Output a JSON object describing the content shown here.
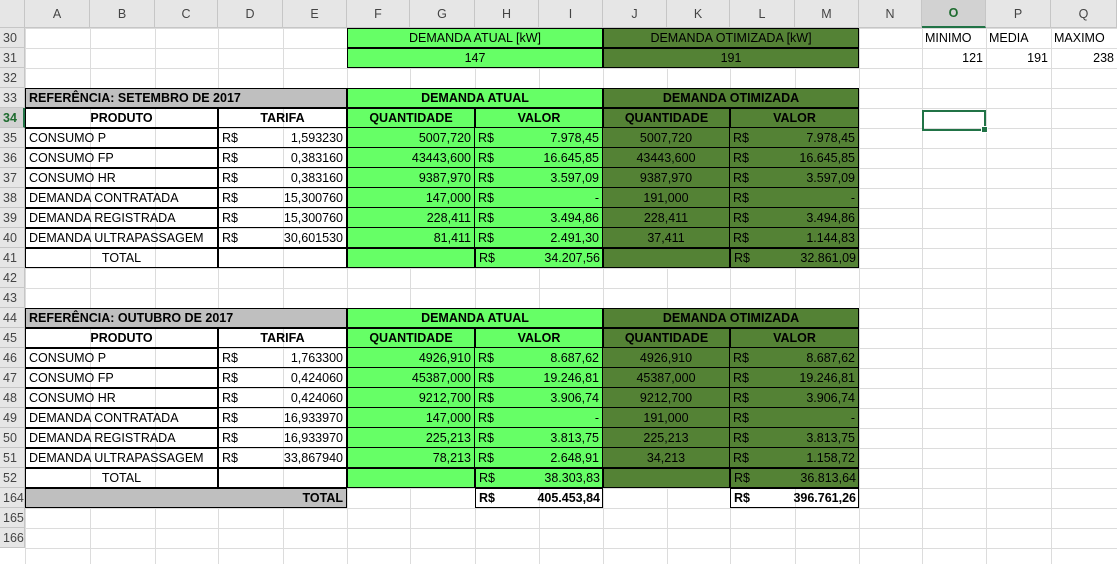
{
  "columns": [
    "A",
    "B",
    "C",
    "D",
    "E",
    "F",
    "G",
    "H",
    "I",
    "J",
    "K",
    "L",
    "M",
    "N",
    "O",
    "P",
    "Q"
  ],
  "rows": [
    "30",
    "31",
    "32",
    "33",
    "34",
    "35",
    "36",
    "37",
    "38",
    "39",
    "40",
    "41",
    "42",
    "43",
    "44",
    "45",
    "46",
    "47",
    "48",
    "49",
    "50",
    "51",
    "52",
    "164",
    "165",
    "166"
  ],
  "selected_column": "O",
  "selected_row": "34",
  "colors": {
    "light_green": "#66ff66",
    "dark_green": "#548235",
    "gray": "#bfbfbf",
    "selection": "#217346"
  },
  "top": {
    "atual_label": "DEMANDA ATUAL [kW]",
    "atual_value": "147",
    "otim_label": "DEMANDA OTIMIZADA [kW]",
    "otim_value": "191",
    "stats_labels": [
      "MINIMO",
      "MEDIA",
      "MAXIMO"
    ],
    "stats_values": [
      "121",
      "191",
      "238"
    ]
  },
  "tables": [
    {
      "title": "REFERÊNCIA: SETEMBRO DE 2017",
      "header_atual": "DEMANDA ATUAL",
      "header_otim": "DEMANDA OTIMIZADA",
      "col_produto": "PRODUTO",
      "col_tarifa": "TARIFA",
      "col_qtd": "QUANTIDADE",
      "col_valor": "VALOR",
      "currency": "R$",
      "rows": [
        {
          "produto": "CONSUMO P",
          "tarifa": "1,593230",
          "qa": "5007,720",
          "va": "7.978,45",
          "qo": "5007,720",
          "vo": "7.978,45"
        },
        {
          "produto": "CONSUMO FP",
          "tarifa": "0,383160",
          "qa": "43443,600",
          "va": "16.645,85",
          "qo": "43443,600",
          "vo": "16.645,85"
        },
        {
          "produto": "CONSUMO HR",
          "tarifa": "0,383160",
          "qa": "9387,970",
          "va": "3.597,09",
          "qo": "9387,970",
          "vo": "3.597,09"
        },
        {
          "produto": "DEMANDA CONTRATADA",
          "tarifa": "15,300760",
          "qa": "147,000",
          "va": "-",
          "qo": "191,000",
          "vo": "-"
        },
        {
          "produto": "DEMANDA REGISTRADA",
          "tarifa": "15,300760",
          "qa": "228,411",
          "va": "3.494,86",
          "qo": "228,411",
          "vo": "3.494,86"
        },
        {
          "produto": "DEMANDA ULTRAPASSAGEM",
          "tarifa": "30,601530",
          "qa": "81,411",
          "va": "2.491,30",
          "qo": "37,411",
          "vo": "1.144,83"
        }
      ],
      "total_label": "TOTAL",
      "total_atual": "34.207,56",
      "total_otim": "32.861,09"
    },
    {
      "title": "REFERÊNCIA: OUTUBRO DE 2017",
      "header_atual": "DEMANDA ATUAL",
      "header_otim": "DEMANDA OTIMIZADA",
      "col_produto": "PRODUTO",
      "col_tarifa": "TARIFA",
      "col_qtd": "QUANTIDADE",
      "col_valor": "VALOR",
      "currency": "R$",
      "rows": [
        {
          "produto": "CONSUMO P",
          "tarifa": "1,763300",
          "qa": "4926,910",
          "va": "8.687,62",
          "qo": "4926,910",
          "vo": "8.687,62"
        },
        {
          "produto": "CONSUMO FP",
          "tarifa": "0,424060",
          "qa": "45387,000",
          "va": "19.246,81",
          "qo": "45387,000",
          "vo": "19.246,81"
        },
        {
          "produto": "CONSUMO HR",
          "tarifa": "0,424060",
          "qa": "9212,700",
          "va": "3.906,74",
          "qo": "9212,700",
          "vo": "3.906,74"
        },
        {
          "produto": "DEMANDA CONTRATADA",
          "tarifa": "16,933970",
          "qa": "147,000",
          "va": "-",
          "qo": "191,000",
          "vo": "-"
        },
        {
          "produto": "DEMANDA REGISTRADA",
          "tarifa": "16,933970",
          "qa": "225,213",
          "va": "3.813,75",
          "qo": "225,213",
          "vo": "3.813,75"
        },
        {
          "produto": "DEMANDA ULTRAPASSAGEM",
          "tarifa": "33,867940",
          "qa": "78,213",
          "va": "2.648,91",
          "qo": "34,213",
          "vo": "1.158,72"
        }
      ],
      "total_label": "TOTAL",
      "total_atual": "38.303,83",
      "total_otim": "36.813,64"
    }
  ],
  "grand_total": {
    "label": "TOTAL",
    "currency": "R$",
    "atual": "405.453,84",
    "otim": "396.761,26"
  }
}
